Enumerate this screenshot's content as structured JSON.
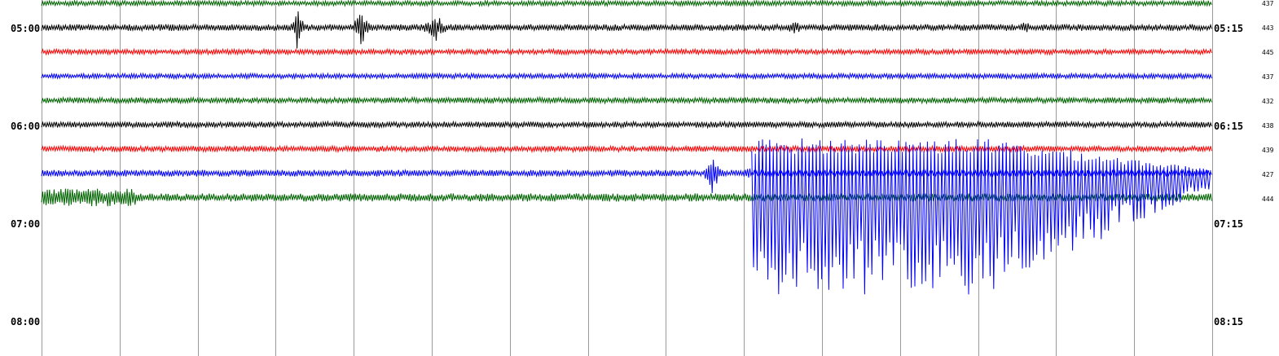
{
  "chart_data": {
    "type": "line",
    "title": "",
    "xlabel": "",
    "ylabel": "",
    "grid": true,
    "left_time_labels": [
      "05:00",
      "06:00",
      "07:00",
      "08:00"
    ],
    "right_time_labels": [
      "05:15",
      "06:15",
      "07:15",
      "08:15"
    ],
    "trace_colors": [
      "#006400",
      "#000000",
      "#ff0000",
      "#0000ff"
    ],
    "traces": [
      {
        "count": "437",
        "color": "#006400",
        "amplitude": 0.35
      },
      {
        "count": "443",
        "color": "#000000",
        "amplitude": 0.45
      },
      {
        "count": "445",
        "color": "#ff0000",
        "amplitude": 0.35
      },
      {
        "count": "437",
        "color": "#0000ff",
        "amplitude": 0.35
      },
      {
        "count": "432",
        "color": "#006400",
        "amplitude": 0.4
      },
      {
        "count": "438",
        "color": "#000000",
        "amplitude": 0.4
      },
      {
        "count": "439",
        "color": "#ff0000",
        "amplitude": 0.4
      },
      {
        "count": "427",
        "color": "#0000ff",
        "amplitude": 0.45
      },
      {
        "count": "444",
        "color": "#006400",
        "amplitude": 0.55
      }
    ],
    "bursts": [
      {
        "trace": 1,
        "minute_start": 3.2,
        "minute_end": 3.35,
        "amplitude": 3
      },
      {
        "trace": 1,
        "minute_start": 4.0,
        "minute_end": 4.2,
        "amplitude": 3.2
      },
      {
        "trace": 1,
        "minute_start": 4.9,
        "minute_end": 5.2,
        "amplitude": 2
      },
      {
        "trace": 1,
        "minute_start": 9.5,
        "minute_end": 9.8,
        "amplitude": 1
      },
      {
        "trace": 1,
        "minute_start": 12.5,
        "minute_end": 12.7,
        "amplitude": 1
      },
      {
        "trace": 7,
        "minute_start": 8.5,
        "minute_end": 8.7,
        "amplitude": 3
      },
      {
        "trace": 7,
        "minute_start": 9.0,
        "minute_end": 9.1,
        "amplitude": 1.5
      }
    ],
    "saturation_event": {
      "trace": 7,
      "minute_start": 9.1,
      "minute_end": 15.0,
      "amplitude_max": 9
    }
  }
}
